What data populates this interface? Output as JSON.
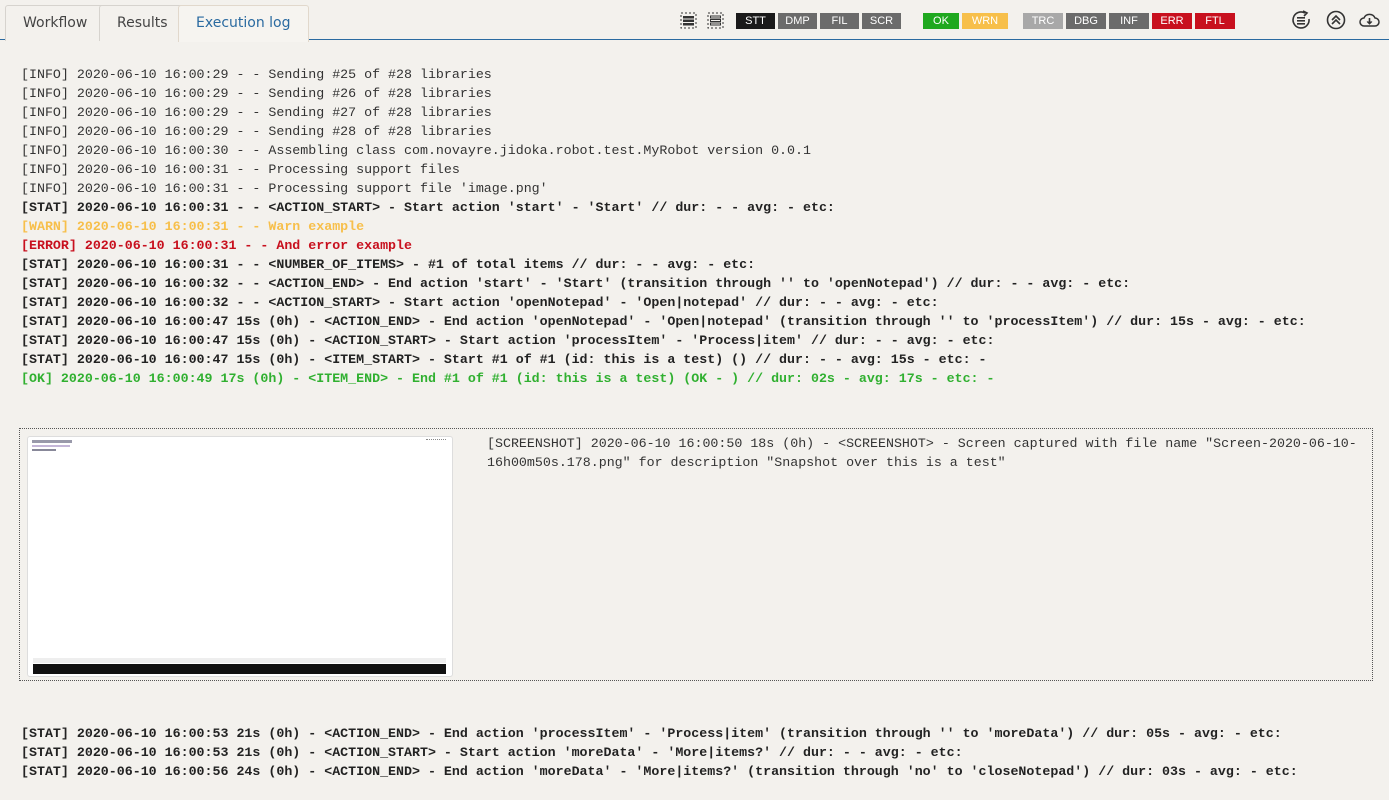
{
  "tabs": [
    {
      "label": "Workflow",
      "active": false
    },
    {
      "label": "Results",
      "active": false
    },
    {
      "label": "Execution log",
      "active": true
    }
  ],
  "toolbar": {
    "icons": [
      "expand-all-icon",
      "collapse-all-icon"
    ],
    "filters_group1": [
      {
        "label": "STT",
        "color": "#1a1a1a"
      },
      {
        "label": "DMP",
        "color": "#6b6b6b"
      },
      {
        "label": "FIL",
        "color": "#6b6b6b"
      },
      {
        "label": "SCR",
        "color": "#6b6b6b"
      }
    ],
    "filters_group2": [
      {
        "label": "OK",
        "color": "#1fa81f"
      },
      {
        "label": "WRN",
        "color": "#f7bf4a"
      }
    ],
    "filters_group3": [
      {
        "label": "TRC",
        "color": "#a8a8a8"
      },
      {
        "label": "DBG",
        "color": "#6b6b6b"
      },
      {
        "label": "INF",
        "color": "#6b6b6b"
      },
      {
        "label": "ERR",
        "color": "#c8101e"
      },
      {
        "label": "FTL",
        "color": "#c8101e"
      }
    ],
    "actions": [
      "refresh-log-icon",
      "scroll-top-icon",
      "download-icon"
    ]
  },
  "log_lines_before": [
    {
      "level": "info",
      "text": "[INFO] 2020-06-10 16:00:29 - - Sending #25 of #28 libraries"
    },
    {
      "level": "info",
      "text": "[INFO] 2020-06-10 16:00:29 - - Sending #26 of #28 libraries"
    },
    {
      "level": "info",
      "text": "[INFO] 2020-06-10 16:00:29 - - Sending #27 of #28 libraries"
    },
    {
      "level": "info",
      "text": "[INFO] 2020-06-10 16:00:29 - - Sending #28 of #28 libraries"
    },
    {
      "level": "info",
      "text": "[INFO] 2020-06-10 16:00:30 - - Assembling class com.novayre.jidoka.robot.test.MyRobot version 0.0.1"
    },
    {
      "level": "info",
      "text": "[INFO] 2020-06-10 16:00:31 - - Processing support files"
    },
    {
      "level": "info",
      "text": "[INFO] 2020-06-10 16:00:31 - - Processing support file 'image.png'"
    },
    {
      "level": "stat",
      "text": "[STAT] 2020-06-10 16:00:31 - - <ACTION_START> - Start action 'start' - 'Start' // dur: - - avg: - etc:"
    },
    {
      "level": "warn",
      "text": "[WARN] 2020-06-10 16:00:31 - - Warn example"
    },
    {
      "level": "error",
      "text": "[ERROR] 2020-06-10 16:00:31 - - And error example"
    },
    {
      "level": "stat",
      "text": "[STAT] 2020-06-10 16:00:31 - - <NUMBER_OF_ITEMS> - #1 of total items // dur: - - avg: - etc:"
    },
    {
      "level": "stat",
      "text": "[STAT] 2020-06-10 16:00:32 - - <ACTION_END> - End action 'start' - 'Start' (transition through '' to 'openNotepad') // dur: - - avg: - etc:"
    },
    {
      "level": "stat",
      "text": "[STAT] 2020-06-10 16:00:32 - - <ACTION_START> - Start action 'openNotepad' - 'Open|notepad' // dur: - - avg: - etc:"
    },
    {
      "level": "stat",
      "text": "[STAT] 2020-06-10 16:00:47 15s (0h) - <ACTION_END> - End action 'openNotepad' - 'Open|notepad' (transition through '' to 'processItem') // dur: 15s - avg: - etc:"
    },
    {
      "level": "stat",
      "text": "[STAT] 2020-06-10 16:00:47 15s (0h) - <ACTION_START> - Start action 'processItem' - 'Process|item' // dur: - - avg: - etc:"
    },
    {
      "level": "stat",
      "text": "[STAT] 2020-06-10 16:00:47 15s (0h) - <ITEM_START> - Start #1 of #1 (id: this is a test) () // dur: - - avg: 15s - etc: -"
    },
    {
      "level": "ok",
      "text": "[OK] 2020-06-10 16:00:49 17s (0h) - <ITEM_END> - End #1 of #1 (id: this is a test) (OK - ) // dur: 02s - avg: 17s - etc: -"
    }
  ],
  "screenshot_entry": {
    "text": "[SCREENSHOT] 2020-06-10 16:00:50 18s (0h) - <SCREENSHOT> - Screen captured with file name \"Screen-2020-06-10-16h00m50s.178.png\" for description \"Snapshot over this is a test\""
  },
  "log_lines_after": [
    {
      "level": "stat",
      "text": "[STAT] 2020-06-10 16:00:53 21s (0h) - <ACTION_END> - End action 'processItem' - 'Process|item' (transition through '' to 'moreData') // dur: 05s - avg: - etc:"
    },
    {
      "level": "stat",
      "text": "[STAT] 2020-06-10 16:00:53 21s (0h) - <ACTION_START> - Start action 'moreData' - 'More|items?' // dur: - - avg: - etc:"
    },
    {
      "level": "stat",
      "text": "[STAT] 2020-06-10 16:00:56 24s (0h) - <ACTION_END> - End action 'moreData' - 'More|items?' (transition through 'no' to 'closeNotepad') // dur: 03s - avg: - etc:"
    }
  ]
}
